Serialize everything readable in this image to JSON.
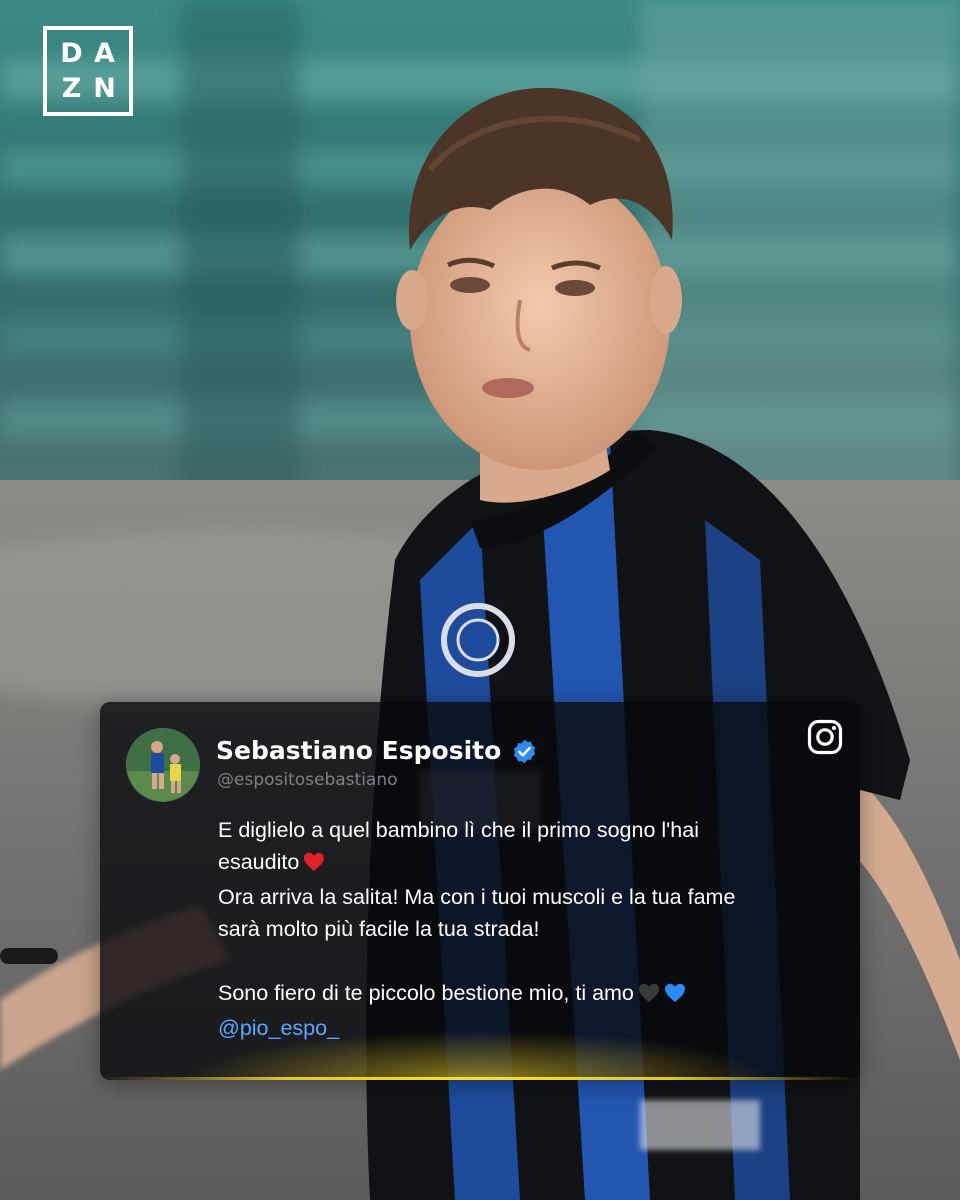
{
  "brand": {
    "logo_letters": [
      "D",
      "A",
      "Z",
      "N"
    ]
  },
  "post": {
    "platform_icon": "instagram-icon",
    "author_name": "Sebastiano Esposito",
    "verified_icon": "verified-badge-icon",
    "handle": "@espositosebastiano",
    "lines": [
      "E diglielo a quel bambino lì che il primo sogno l'hai",
      "esaudito",
      "Ora arriva la salita! Ma con i tuoi muscoli e la tua fame",
      "sarà molto più facile la tua strada!",
      "Sono fiero di te piccolo bestione mio, ti amo"
    ],
    "emojis": {
      "line2": "red-heart-emoji",
      "line5": [
        "black-heart-emoji",
        "blue-heart-emoji"
      ]
    },
    "mention": "@pio_espo_"
  },
  "colors": {
    "card_bg": "#08090c",
    "accent_glow": "#f7e02a",
    "mention": "#5aa7ff",
    "verified": "#2f8bf0",
    "handle": "#7d8088"
  }
}
